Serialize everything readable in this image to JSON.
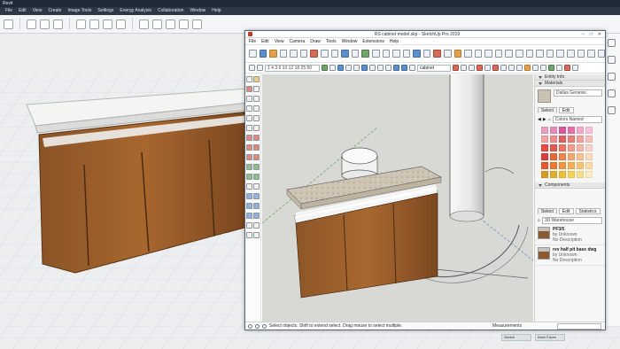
{
  "revit": {
    "title": "Revit",
    "menu": [
      "File",
      "Edit",
      "View",
      "Create",
      "Image Tools",
      "Settings",
      "Energy Analysis",
      "Collaboration",
      "Window",
      "Help"
    ],
    "status_buttons": [
      "Sketch",
      "Back Faces"
    ]
  },
  "sketchup": {
    "title": "RS cabinet model.skp - SketchUp Pro 2019",
    "menu": [
      "File",
      "Edit",
      "View",
      "Camera",
      "Draw",
      "Tools",
      "Window",
      "Extensions",
      "Help"
    ],
    "scene_field": "cabinet",
    "scale_field": "1 4 3 6 10 12 18 25 50",
    "status_text": "Select objects. Shift to extend select. Drag mouse to select multiple.",
    "measurements_label": "Measurements"
  },
  "tray": {
    "entity_info_label": "Entity Info",
    "materials_label": "Materials",
    "material_name": "Dallas Genesis",
    "select_tab": "Select",
    "edit_tab": "Edit",
    "collection": "Colors Named",
    "components_label": "Components",
    "comp_tabs": [
      "Select",
      "Edit",
      "Statistics"
    ],
    "comp_search": "3D Warehouse",
    "components": [
      {
        "name": "PF3/5",
        "by": "by Unknown",
        "desc": "No Description"
      },
      {
        "name": "rev half pit base dwg",
        "by": "by Unknown",
        "desc": "No Description"
      }
    ]
  },
  "colors": {
    "palette": [
      "#e8a0c0",
      "#e08cb4",
      "#d8589a",
      "#ec6ea8",
      "#f4a8c8",
      "#f7c2d8",
      "#f2a3a6",
      "#ee8c8e",
      "#e15f62",
      "#ea7c79",
      "#f1a19a",
      "#f6c0bb",
      "#e84848",
      "#e25a52",
      "#ef7364",
      "#f59a8c",
      "#f3b5a4",
      "#f8d3c7",
      "#d83c3c",
      "#e8683c",
      "#ee8450",
      "#f5a66c",
      "#f8c292",
      "#fbdcbc",
      "#e55a2a",
      "#ef7a32",
      "#f29640",
      "#f6ae52",
      "#f8c474",
      "#fbdca4",
      "#d69a28",
      "#e2ae30",
      "#ecc03a",
      "#f3d254",
      "#f7e08a",
      "#fbedc0"
    ]
  }
}
